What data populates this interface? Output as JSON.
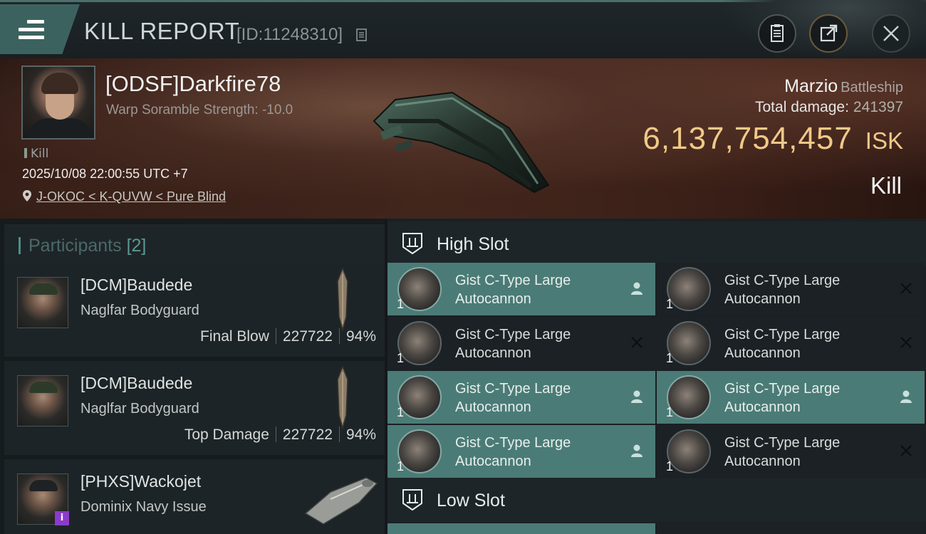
{
  "header": {
    "title": "KILL REPORT",
    "report_id": "[ID:11248310]"
  },
  "victim": {
    "pilot": "[ODSF]Darkfire78",
    "warp_scramble": "Warp Soramble Strength: -10.0",
    "tag": "Kill",
    "datetime": "2025/10/08 22:00:55 UTC +7",
    "location": "J-OKOC < K-QUVW < Pure Blind",
    "ship_name": "Marzio",
    "ship_class": "Battleship",
    "total_damage_label": "Total damage:",
    "total_damage": "241397",
    "isk_value": "6,137,754,457",
    "isk_unit": "ISK",
    "result": "Kill"
  },
  "participants": {
    "label": "Participants",
    "count": "[2]",
    "items": [
      {
        "name": "[DCM]Baudede",
        "ship": "Naglfar Bodyguard",
        "role": "Final Blow",
        "damage": "227722",
        "percent": "94%"
      },
      {
        "name": "[DCM]Baudede",
        "ship": "Naglfar Bodyguard",
        "role": "Top Damage",
        "damage": "227722",
        "percent": "94%"
      },
      {
        "name": "[PHXS]Wackojet",
        "ship": "Dominix Navy Issue",
        "badge": "i"
      }
    ]
  },
  "slots": {
    "high_label": "High Slot",
    "low_label": "Low Slot",
    "high_modules": [
      {
        "name_line1": "Gist C-Type Large",
        "name_line2": "Autocannon",
        "qty": "1",
        "state": "dropped"
      },
      {
        "name_line1": "Gist C-Type Large",
        "name_line2": "Autocannon",
        "qty": "1",
        "state": "destroyed"
      },
      {
        "name_line1": "Gist C-Type Large",
        "name_line2": "Autocannon",
        "qty": "1",
        "state": "destroyed"
      },
      {
        "name_line1": "Gist C-Type Large",
        "name_line2": "Autocannon",
        "qty": "1",
        "state": "destroyed"
      },
      {
        "name_line1": "Gist C-Type Large",
        "name_line2": "Autocannon",
        "qty": "1",
        "state": "dropped"
      },
      {
        "name_line1": "Gist C-Type Large",
        "name_line2": "Autocannon",
        "qty": "1",
        "state": "dropped"
      },
      {
        "name_line1": "Gist C-Type Large",
        "name_line2": "Autocannon",
        "qty": "1",
        "state": "dropped"
      },
      {
        "name_line1": "Gist C-Type Large",
        "name_line2": "Autocannon",
        "qty": "1",
        "state": "destroyed"
      }
    ]
  },
  "colors": {
    "accent_teal": "#4b7b76",
    "isk_gold": "#f0c989",
    "badge_purple": "#8a3cc9"
  },
  "icons": [
    "menu-icon",
    "copy-icon",
    "clipboard-icon",
    "share-icon",
    "close-icon",
    "location-pin-icon",
    "high-slot-icon",
    "low-slot-icon",
    "pilot-dropped-icon",
    "destroyed-x-icon"
  ]
}
